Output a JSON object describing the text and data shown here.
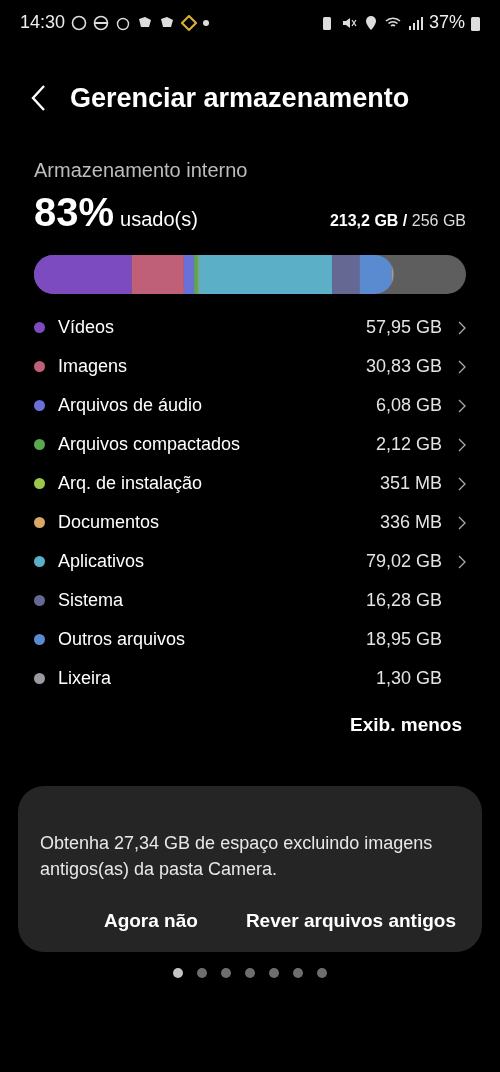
{
  "status_bar": {
    "time": "14:30",
    "battery": "37%"
  },
  "header": {
    "title": "Gerenciar armazenamento"
  },
  "storage": {
    "title": "Armazenamento interno",
    "percent": "83%",
    "used_label": "usado(s)",
    "total": "**213,2 GB /** 256 GB"
  },
  "categories": [
    {
      "name": "Vídeos",
      "size": "57,95 GB",
      "color": "#7b4bbf",
      "has_chevron": true
    },
    {
      "name": "Imagens",
      "size": "30,83 GB",
      "color": "#c06078",
      "has_chevron": true
    },
    {
      "name": "Arquivos de áudio",
      "size": "6,08 GB",
      "color": "#6a70d8",
      "has_chevron": true
    },
    {
      "name": "Arquivos compactados",
      "size": "2,12 GB",
      "color": "#5aa84e",
      "has_chevron": true
    },
    {
      "name": "Arq. de instalação",
      "size": "351 MB",
      "color": "#9cc84a",
      "has_chevron": true
    },
    {
      "name": "Documentos",
      "size": "336 MB",
      "color": "#d9a865",
      "has_chevron": true
    },
    {
      "name": "Aplicativos",
      "size": "79,02 GB",
      "color": "#5bb0c8",
      "has_chevron": true
    },
    {
      "name": "Sistema",
      "size": "16,28 GB",
      "color": "#666894",
      "has_chevron": false
    },
    {
      "name": "Outros arquivos",
      "size": "18,95 GB",
      "color": "#5a8ad0",
      "has_chevron": false
    },
    {
      "name": "Lixeira",
      "size": "1,30 GB",
      "color": "#9a9aa0",
      "has_chevron": false
    }
  ],
  "show_less": "Exib. menos",
  "suggestion": {
    "text": "Obtenha 27,34 GB de espaço excluindo imagens antigos(as) da pasta Camera.",
    "buttons": [
      "Agora não",
      "Rever arquivos antigos"
    ]
  },
  "pager": [
    {
      "selected": true
    },
    {
      "selected": false
    },
    {
      "selected": false
    },
    {
      "selected": false
    },
    {
      "selected": false
    },
    {
      "selected": false
    },
    {
      "selected": false
    }
  ]
}
